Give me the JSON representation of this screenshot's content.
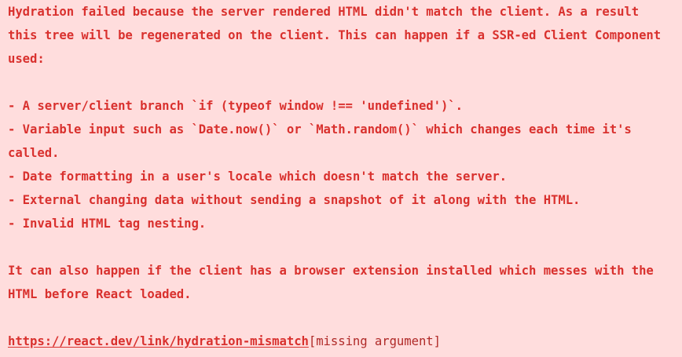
{
  "error": {
    "intro": "Hydration failed because the server rendered HTML didn't match the client. As a result this tree will be regenerated on the client. This can happen if a SSR-ed Client Component used:",
    "causes": [
      "- A server/client branch `if (typeof window !== 'undefined')`.",
      "- Variable input such as `Date.now()` or `Math.random()` which changes each time it's called.",
      "- Date formatting in a user's locale which doesn't match the server.",
      "- External changing data without sending a snapshot of it along with the HTML.",
      "- Invalid HTML tag nesting."
    ],
    "extension_note": "It can also happen if the client has a browser extension installed which messes with the HTML before React loaded.",
    "link_text": "https://react.dev/link/hydration-mismatch",
    "link_suffix": "[missing argument]"
  },
  "colors": {
    "background": "#ffdddd",
    "text": "#d9312e"
  }
}
